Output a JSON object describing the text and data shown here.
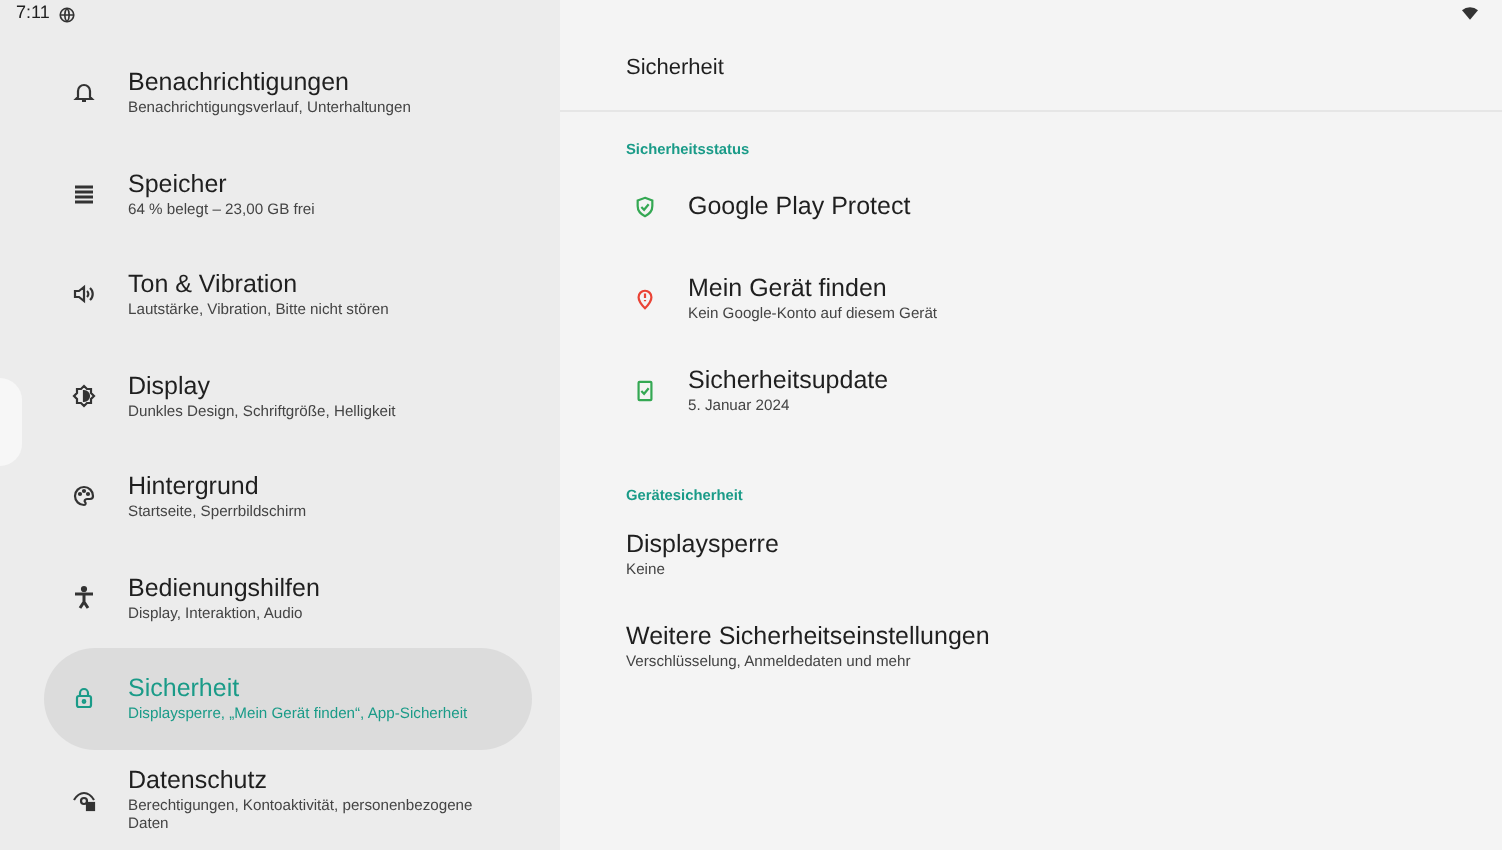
{
  "status_bar": {
    "time": "7:11"
  },
  "sidebar": {
    "items": [
      {
        "title": "Benachrichtigungen",
        "subtitle": "Benachrichtigungsverlauf, Unterhaltungen",
        "selected": false
      },
      {
        "title": "Speicher",
        "subtitle": "64 % belegt – 23,00 GB frei",
        "selected": false
      },
      {
        "title": "Ton & Vibration",
        "subtitle": "Lautstärke, Vibration, Bitte nicht stören",
        "selected": false
      },
      {
        "title": "Display",
        "subtitle": "Dunkles Design, Schriftgröße, Helligkeit",
        "selected": false
      },
      {
        "title": "Hintergrund",
        "subtitle": "Startseite, Sperrbildschirm",
        "selected": false
      },
      {
        "title": "Bedienungshilfen",
        "subtitle": "Display, Interaktion, Audio",
        "selected": false
      },
      {
        "title": "Sicherheit",
        "subtitle": "Displaysperre, „Mein Gerät finden“, App-Sicherheit",
        "selected": true
      },
      {
        "title": "Datenschutz",
        "subtitle": "Berechtigungen, Kontoaktivität, personenbezogene Daten",
        "selected": false
      }
    ]
  },
  "page": {
    "title": "Sicherheit",
    "sections": [
      {
        "header": "Sicherheitsstatus",
        "items": [
          {
            "title": "Google Play Protect",
            "color": "#34a853"
          },
          {
            "title": "Mein Gerät finden",
            "subtitle": "Kein Google-Konto auf diesem Gerät",
            "color": "#ea4335"
          },
          {
            "title": "Sicherheitsupdate",
            "subtitle": "5. Januar 2024",
            "color": "#34a853"
          }
        ]
      },
      {
        "header": "Gerätesicherheit",
        "items": [
          {
            "title": "Displaysperre",
            "subtitle": "Keine"
          },
          {
            "title": "Weitere Sicherheitseinstellungen",
            "subtitle": "Verschlüsselung, Anmeldedaten und mehr"
          }
        ]
      }
    ]
  }
}
